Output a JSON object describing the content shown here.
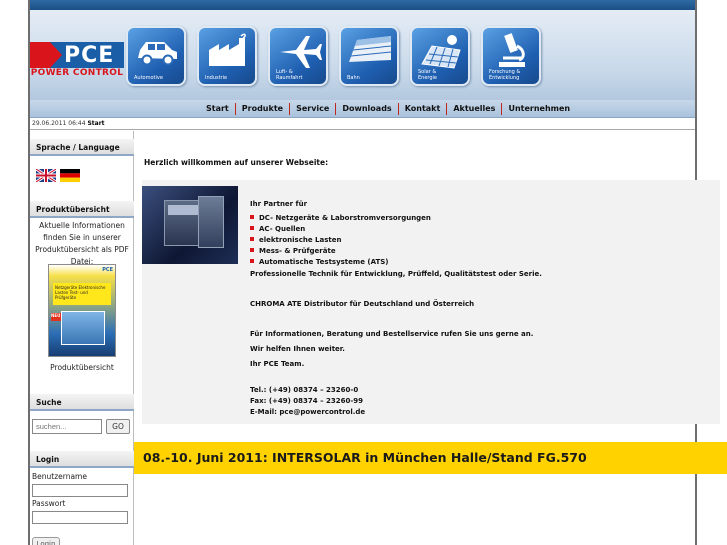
{
  "header": {
    "logo_main": "PCE",
    "logo_sub": "POWER CONTROL",
    "categories": [
      {
        "label": "Automotive",
        "icon": "car-icon"
      },
      {
        "label": "Industrie",
        "icon": "factory-icon"
      },
      {
        "label": "Luft- &\nRaumfahrt",
        "icon": "airplane-icon"
      },
      {
        "label": "Bahn",
        "icon": "train-icon"
      },
      {
        "label": "Solar &\nEnergie",
        "icon": "solar-icon"
      },
      {
        "label": "Forschung &\nEntwicklung",
        "icon": "microscope-icon"
      }
    ]
  },
  "nav": {
    "items": [
      "Start",
      "Produkte",
      "Service",
      "Downloads",
      "Kontakt",
      "Aktuelles",
      "Unternehmen"
    ]
  },
  "breadcrumb": {
    "datetime": "29.06.2011 06:44",
    "page": "Start"
  },
  "sidebar": {
    "language_title": "Sprache / Language",
    "product_title": "Produktübersicht",
    "product_text": "Aktuelle Informationen finden Sie in unserer Produktübersicht als PDF Datei:",
    "product_link": "Produktübersicht",
    "brochure_text": "Netzgeräte Elektronische Lasten Test- und Prüfgeräte",
    "brochure_badge": "NEU",
    "brochure_logo": "PCE",
    "search_title": "Suche",
    "search_placeholder": "suchen...",
    "go_label": "GO",
    "login_title": "Login",
    "username_label": "Benutzername",
    "password_label": "Passwort",
    "login_button": "Login"
  },
  "main": {
    "welcome": "Herzlich willkommen auf unserer Webseite:",
    "partner_intro": "Ihr Partner für",
    "bullets": [
      "DC- Netzgeräte & Laborstromversorgungen",
      "AC- Quellen",
      "elektronische Lasten",
      "Mess- & Prüfgeräte",
      "Automatische Testsysteme (ATS)"
    ],
    "tagline": "Professionelle Technik für Entwicklung, Prüffeld, Qualitätstest oder Serie.",
    "chroma": "CHROMA ATE Distributor für Deutschland und Österreich",
    "info1": "Für Informationen, Beratung und Bestellservice rufen Sie uns gerne an.",
    "info2": "Wir helfen Ihnen weiter.",
    "info3": "Ihr PCE Team.",
    "tel": "Tel.: (+49) 08374 – 23260-0",
    "fax": "Fax: (+49) 08374 – 23260-99",
    "email": "E-Mail: pce@powercontrol.de"
  },
  "banner": {
    "text": "08.-10. Juni 2011: INTERSOLAR in München Halle/Stand FG.570"
  },
  "colors": {
    "brand_blue": "#1a5ea8",
    "brand_red": "#d9141b",
    "banner_yellow": "#ffd200"
  }
}
